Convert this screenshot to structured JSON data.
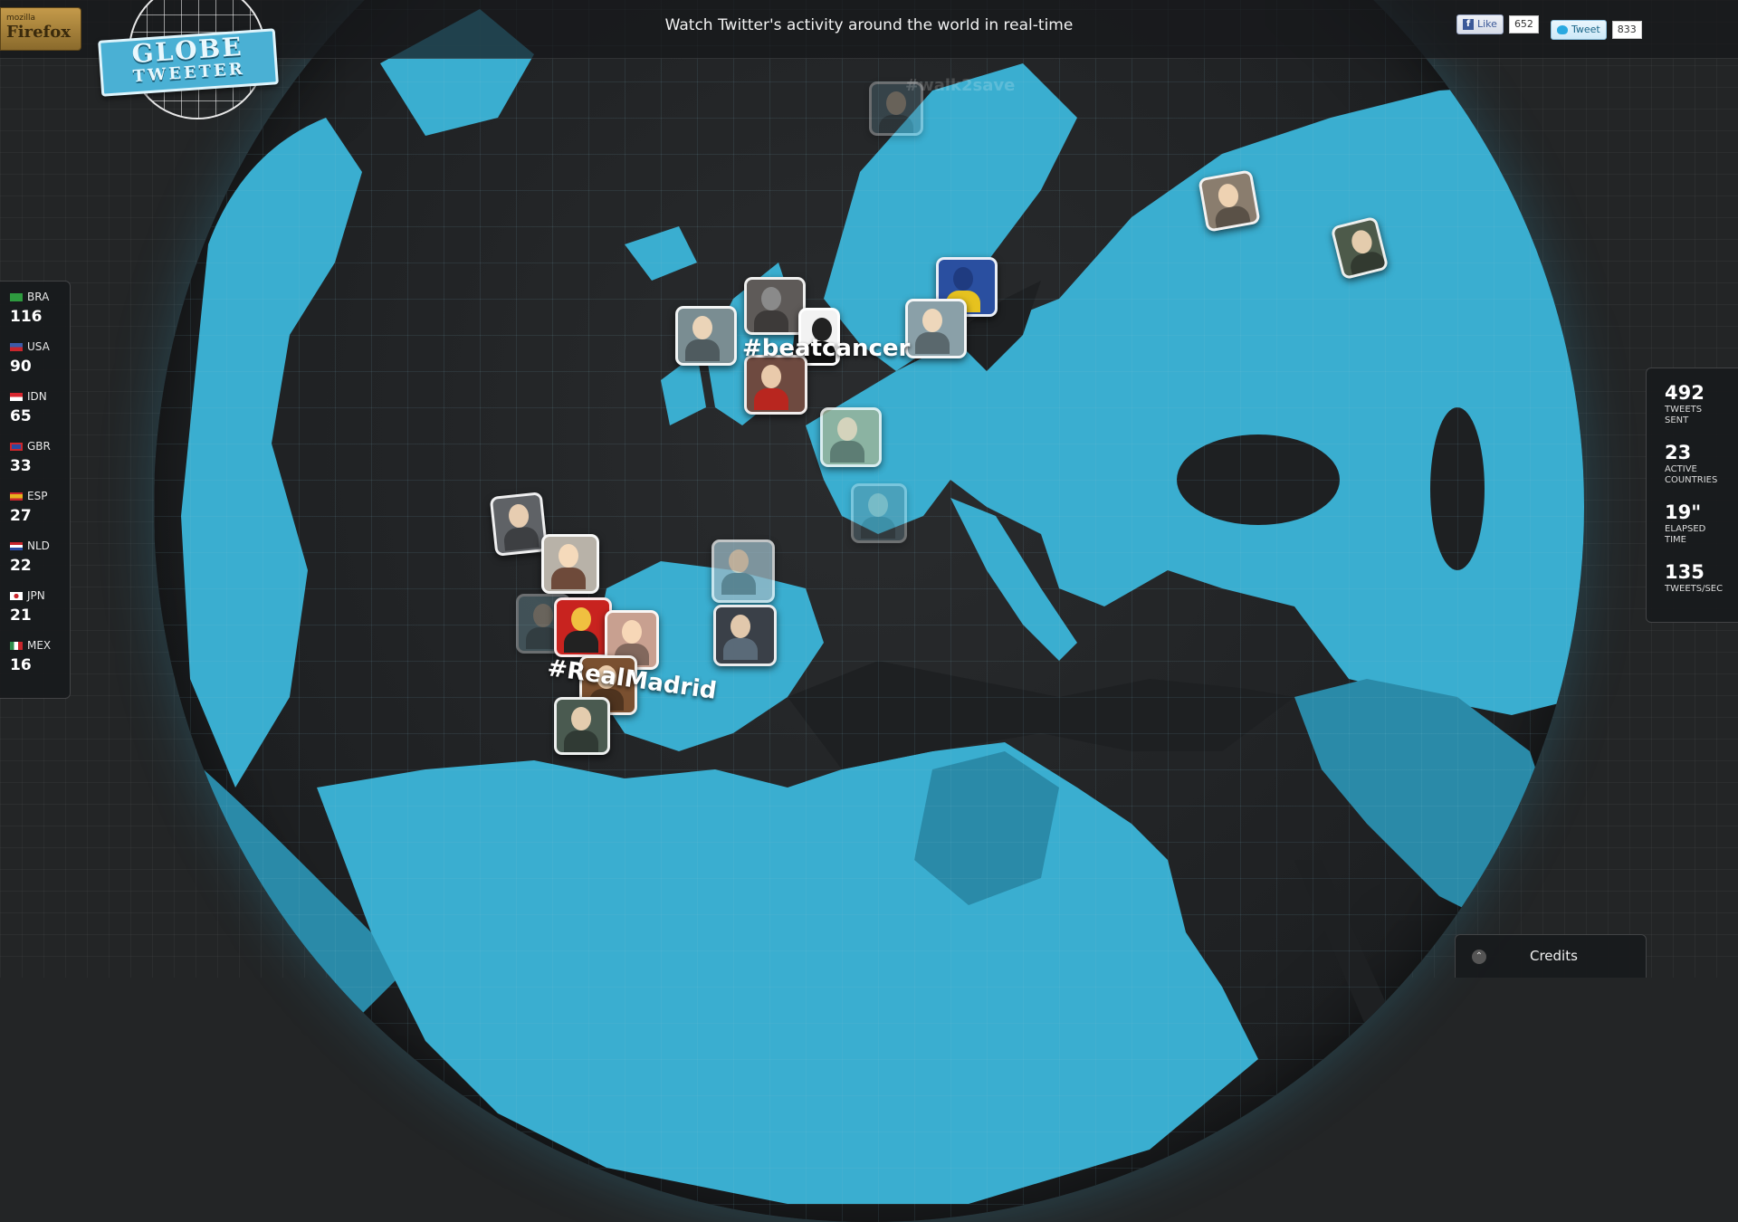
{
  "header": {
    "tagline": "Watch Twitter's activity around the world in real-time",
    "browser_badge": {
      "small": "mozilla",
      "big": "Firefox"
    },
    "logo": {
      "line1": "GLOBE",
      "line2": "TWEETER"
    },
    "facebook": {
      "label": "Like",
      "count": "652"
    },
    "twitter": {
      "label": "Tweet",
      "count": "833"
    }
  },
  "countries": [
    {
      "code": "BRA",
      "count": "116",
      "flag_color": "#2e9b3f"
    },
    {
      "code": "USA",
      "count": "90",
      "flag_color": "#3c5ba8"
    },
    {
      "code": "IDN",
      "count": "65",
      "flag_color": "#d8262e"
    },
    {
      "code": "GBR",
      "count": "33",
      "flag_color": "#2b4aa0"
    },
    {
      "code": "ESP",
      "count": "27",
      "flag_color": "#e8b21f"
    },
    {
      "code": "NLD",
      "count": "22",
      "flag_color": "#c9262c"
    },
    {
      "code": "JPN",
      "count": "21",
      "flag_color": "#ffffff"
    },
    {
      "code": "MEX",
      "count": "16",
      "flag_color": "#2e8b4a"
    }
  ],
  "stats": [
    {
      "value": "492",
      "label": "TWEETS SENT"
    },
    {
      "value": "23",
      "label": "ACTIVE COUNTRIES"
    },
    {
      "value": "19\"",
      "label": "ELAPSED TIME"
    },
    {
      "value": "135",
      "label": "TWEETS/SEC"
    }
  ],
  "hashtags": [
    "#beatcancer",
    "#RealMadrid",
    "#walk2save"
  ],
  "credits": {
    "label": "Credits"
  },
  "colors": {
    "land": "#3aaed0",
    "land_dark": "#2a8aa8",
    "ocean": "#1e2022",
    "accent": "#4ab0d4"
  }
}
